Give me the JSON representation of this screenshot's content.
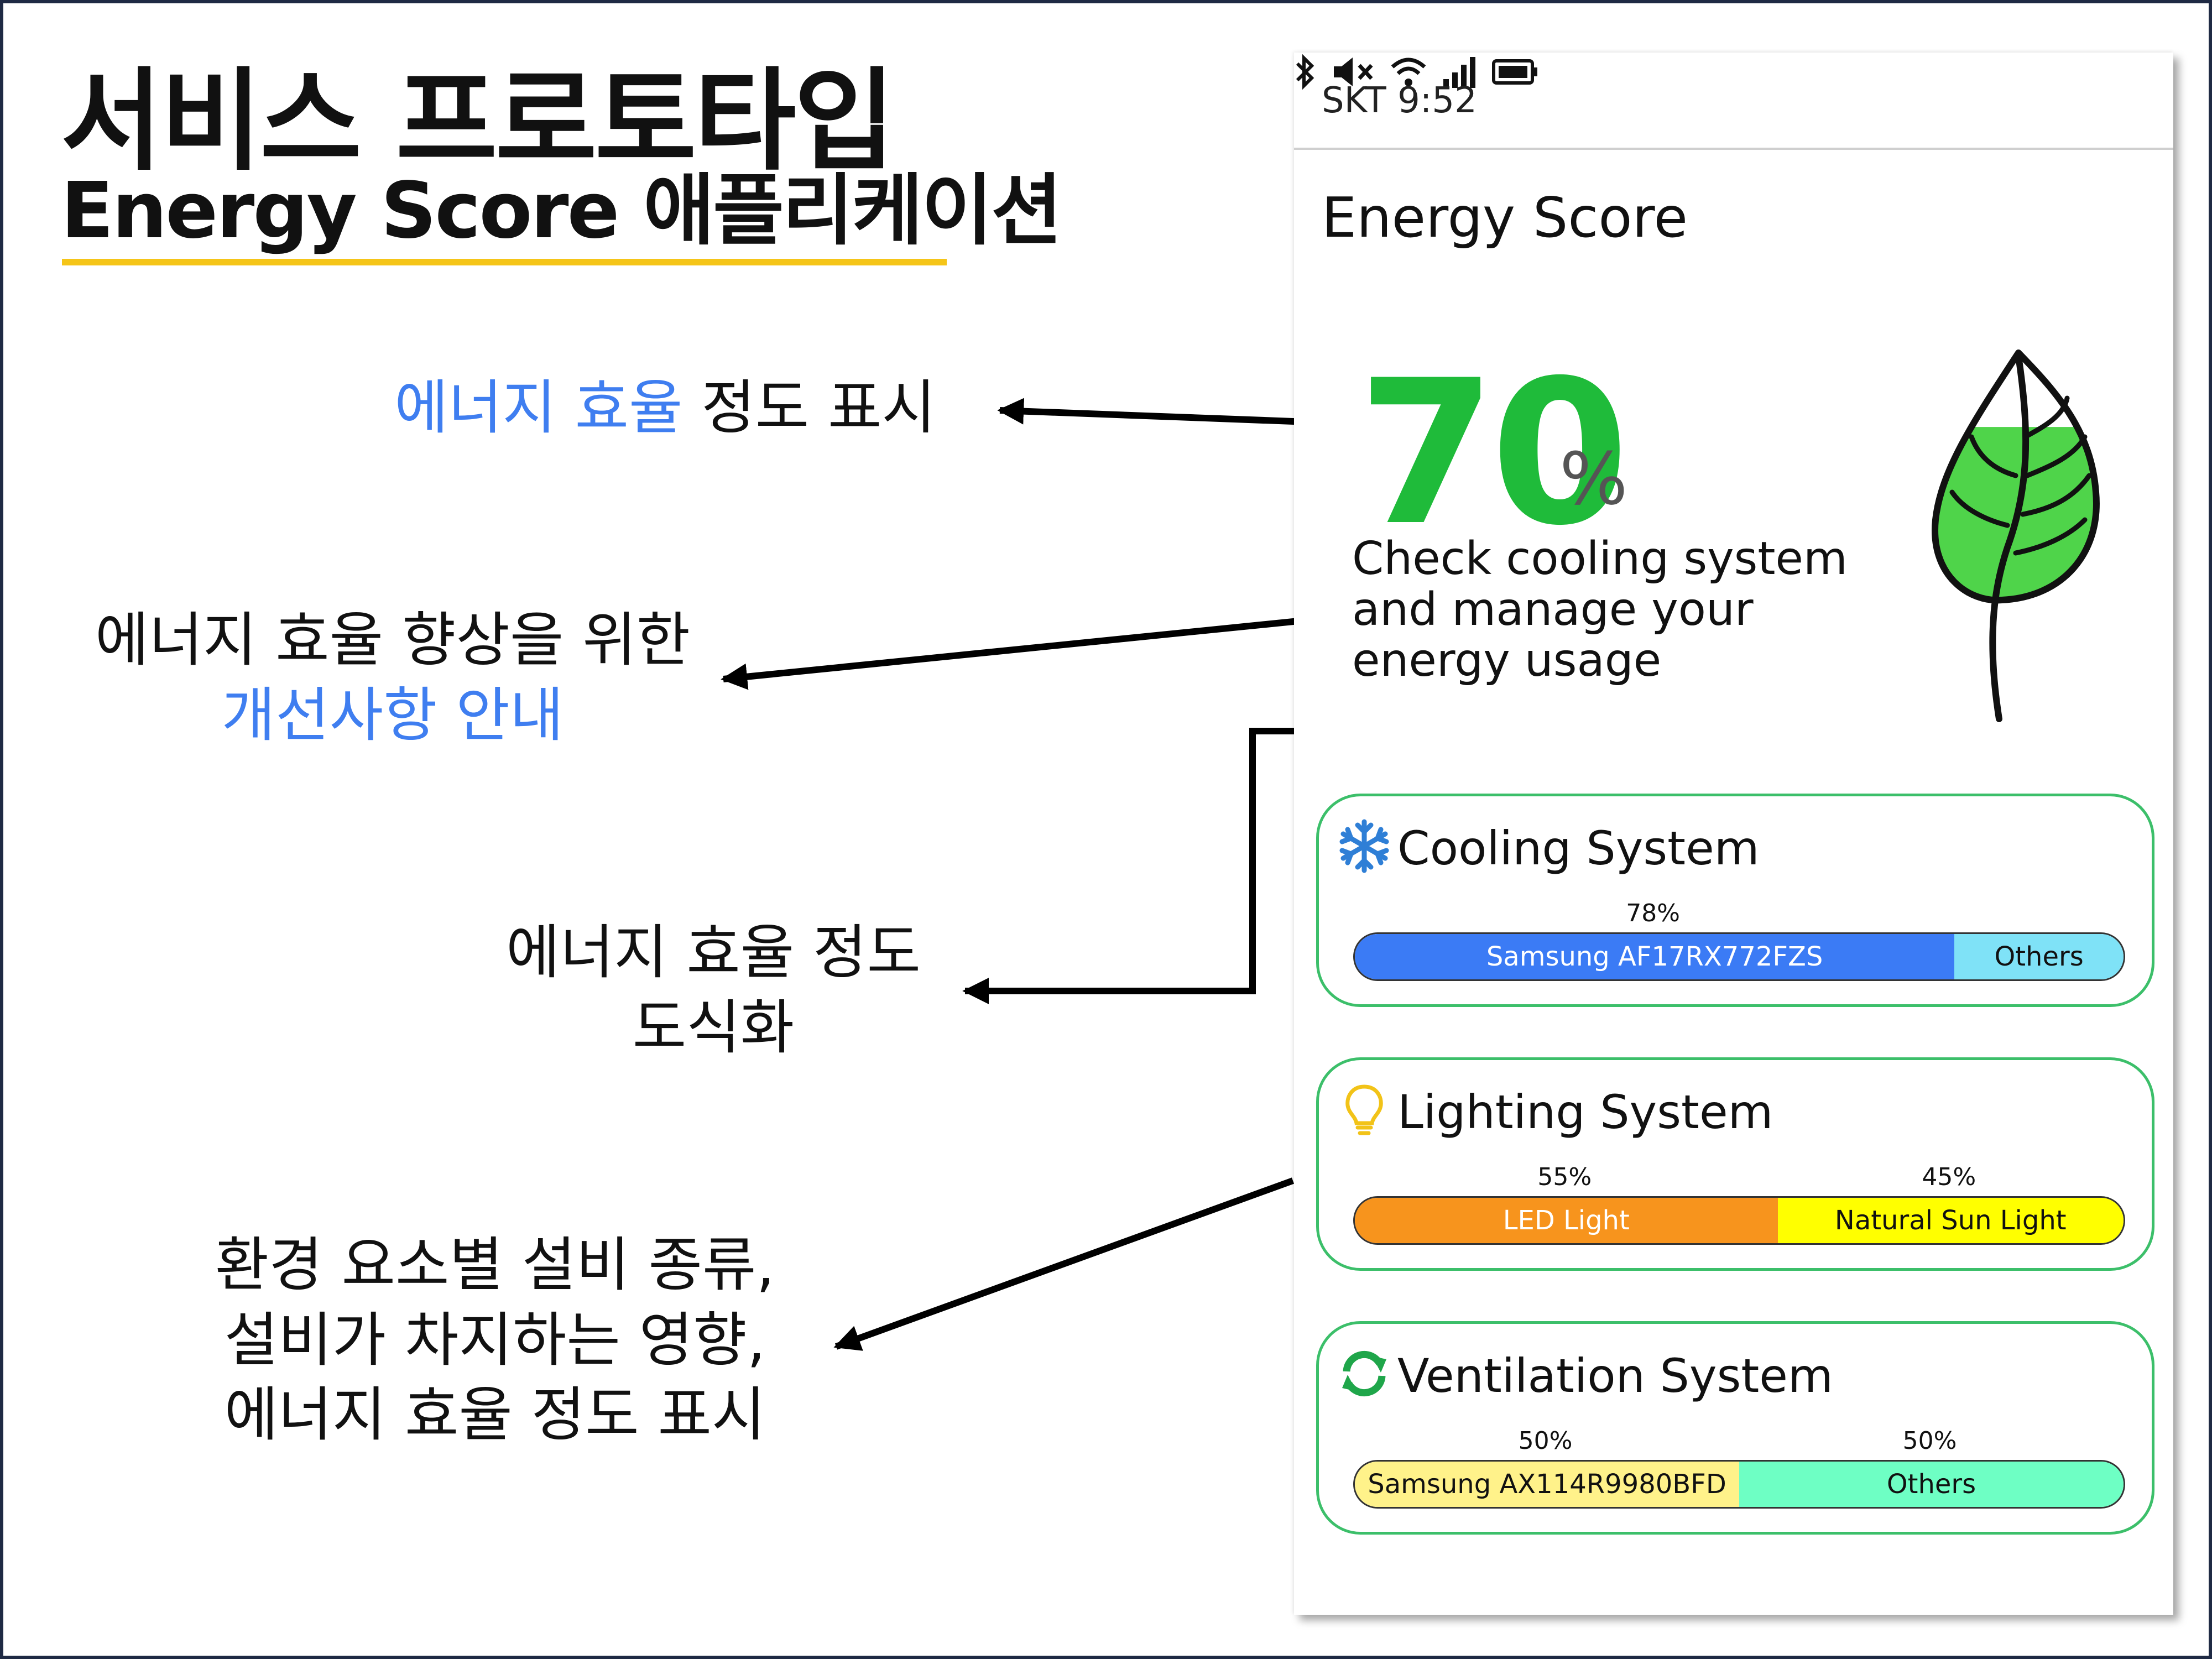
{
  "slide": {
    "title": "서비스 프로토타입",
    "subtitle": "Energy Score 애플리케이션"
  },
  "annotations": {
    "a1": {
      "highlight": "에너지 효율",
      "rest": " 정도 표시"
    },
    "a2": {
      "line1": "에너지 효율 향상을 위한",
      "line2": "개선사항 안내"
    },
    "a3": {
      "line1": "에너지 효율 정도",
      "line2": "도식화"
    },
    "a4": {
      "line1": "환경 요소별 설비 종류,",
      "line2": "설비가 차지하는 영향,",
      "line3": "에너지 효율 정도 표시"
    }
  },
  "phone": {
    "status": {
      "carrier_time": "SKT 9:52",
      "icons": [
        "bluetooth-icon",
        "mute-icon",
        "wifi-icon",
        "signal-icon",
        "battery-icon"
      ]
    },
    "app_title": "Energy Score",
    "score": {
      "value": "70",
      "unit": "%",
      "color": "#1fbb3a"
    },
    "message": "Check cooling system\nand manage your\nenergy  usage",
    "leaf_fill_level": 0.7,
    "cards": [
      {
        "title": "Cooling System",
        "icon": "snowflake-icon",
        "segments": [
          {
            "label": "Samsung AF17RX772FZS",
            "share": 78,
            "pct_label": "78%",
            "color": "#3b7bf5",
            "text_color": "#ffffff"
          },
          {
            "label": "Others",
            "share": 22,
            "pct_label": "",
            "color": "#7fe2f7",
            "text_color": "#111111"
          }
        ]
      },
      {
        "title": "Lighting System",
        "icon": "lightbulb-icon",
        "segments": [
          {
            "label": "LED Light",
            "share": 55,
            "pct_label": "55%",
            "color": "#f7941d",
            "text_color": "#ffffff"
          },
          {
            "label": "Natural Sun Light",
            "share": 45,
            "pct_label": "45%",
            "color": "#ffff00",
            "text_color": "#111111"
          }
        ]
      },
      {
        "title": "Ventilation System",
        "icon": "recycle-arrows-icon",
        "segments": [
          {
            "label": "Samsung AX114R9980BFD",
            "share": 50,
            "pct_label": "50%",
            "color": "#fff28a",
            "text_color": "#111111"
          },
          {
            "label": "Others",
            "share": 50,
            "pct_label": "50%",
            "color": "#6effc4",
            "text_color": "#111111"
          }
        ]
      }
    ]
  }
}
